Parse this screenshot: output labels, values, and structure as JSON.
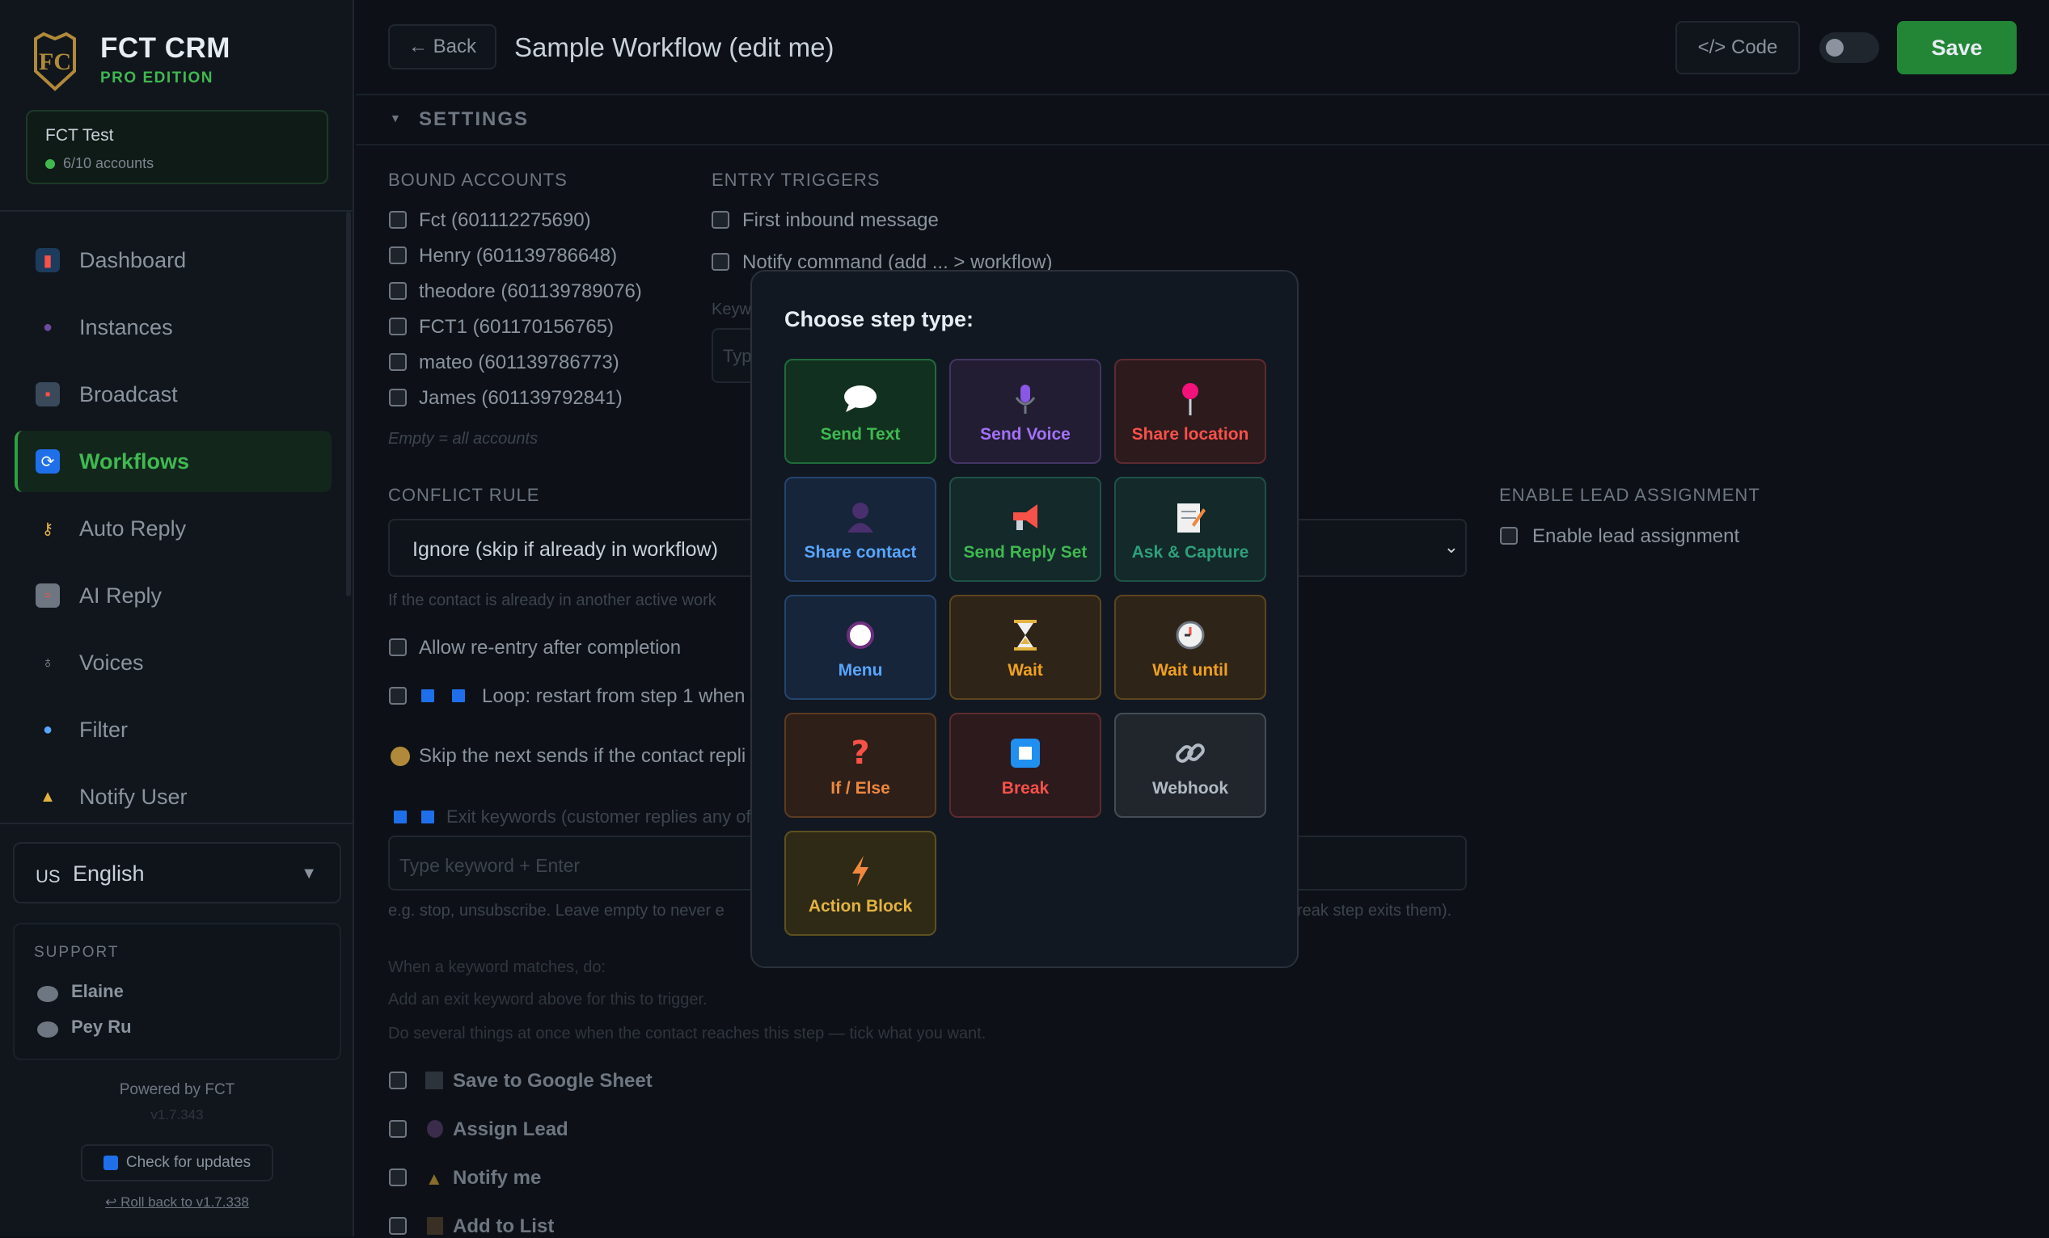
{
  "sidebar": {
    "brand": "FCT CRM",
    "edition": "PRO EDITION",
    "account": {
      "name": "FCT Test",
      "count": "6/10 accounts"
    },
    "nav": [
      {
        "label": "Dashboard",
        "icon": "chart-icon"
      },
      {
        "label": "Instances",
        "icon": "person-icon"
      },
      {
        "label": "Broadcast",
        "icon": "inbox-icon"
      },
      {
        "label": "Workflows",
        "icon": "refresh-icon",
        "active": true
      },
      {
        "label": "Auto Reply",
        "icon": "key-icon"
      },
      {
        "label": "AI Reply",
        "icon": "robot-icon"
      },
      {
        "label": "Voices",
        "icon": "microphone-icon"
      },
      {
        "label": "Filter",
        "icon": "magnifier-icon"
      },
      {
        "label": "Notify User",
        "icon": "bell-icon"
      }
    ],
    "language": {
      "flag": "US",
      "label": "English"
    },
    "support": {
      "heading": "SUPPORT",
      "people": [
        "Elaine",
        "Pey Ru"
      ]
    },
    "powered_by": "Powered by FCT",
    "version": "v1.7.343",
    "check_updates": "Check for updates",
    "rollback": "↩ Roll back to v1.7.338"
  },
  "header": {
    "back_label": "← Back",
    "title": "Sample Workflow (edit me)",
    "code_label": "</> Code",
    "save_label": "Save"
  },
  "settings": {
    "heading": "SETTINGS",
    "bound_accounts": {
      "heading": "BOUND ACCOUNTS",
      "items": [
        "Fct (601112275690)",
        "Henry (601139786648)",
        "theodore (601139789076)",
        "FCT1 (601170156765)",
        "mateo (601139786773)",
        "James (601139792841)"
      ],
      "hint": "Empty = all accounts"
    },
    "entry_triggers": {
      "heading": "ENTRY TRIGGERS",
      "items": [
        "First inbound message",
        "Notify command (add ... > workflow)"
      ],
      "keyword_label": "Keyw",
      "keyword_placeholder": "Typ"
    },
    "conflict_rule": {
      "heading": "CONFLICT RULE",
      "value": "Ignore (skip if already in workflow)",
      "hint": "If the contact is already in another active work"
    },
    "lead": {
      "heading": "ENABLE LEAD ASSIGNMENT",
      "label": "Enable lead assignment"
    },
    "allow_reentry": "Allow re-entry after completion",
    "loop_label": "Loop: restart from step 1 when",
    "skip_label": "Skip the next sends if the contact repli",
    "exit_keywords_label": "Exit keywords (customer replies any of",
    "keyword_input_placeholder": "Type keyword + Enter",
    "keyword_hint_left": "e.g. stop, unsubscribe. Leave empty to never e",
    "keyword_hint_right": "reak step exits them).",
    "when_match": "When a keyword matches, do:",
    "add_exit_hint": "Add an exit keyword above for this to trigger.",
    "several_hint": "Do several things at once when the contact reaches this step — tick what you want.",
    "actions": [
      "Save to Google Sheet",
      "Assign Lead",
      "Notify me",
      "Add to List"
    ]
  },
  "modal": {
    "title": "Choose step type:",
    "tiles": [
      {
        "label": "Send Text",
        "icon": "speech-bubble-icon",
        "color": "#3fb950",
        "bg": "#12301f",
        "border": "#1f6b3a"
      },
      {
        "label": "Send Voice",
        "icon": "microphone-icon",
        "color": "#a371f7",
        "bg": "#221d33",
        "border": "#433563"
      },
      {
        "label": "Share location",
        "icon": "pin-icon",
        "color": "#f85149",
        "bg": "#2d1a1d",
        "border": "#5c2b30"
      },
      {
        "label": "Share contact",
        "icon": "person-icon",
        "color": "#58a6ff",
        "bg": "#16253a",
        "border": "#24446c"
      },
      {
        "label": "Send Reply Set",
        "icon": "megaphone-icon",
        "color": "#3fb950",
        "bg": "#13292a",
        "border": "#1f5247"
      },
      {
        "label": "Ask & Capture",
        "icon": "memo-icon",
        "color": "#2ea07a",
        "bg": "#13292a",
        "border": "#1f5247"
      },
      {
        "label": "Menu",
        "icon": "circle-icon",
        "color": "#58a6ff",
        "bg": "#16253a",
        "border": "#24446c"
      },
      {
        "label": "Wait",
        "icon": "hourglass-icon",
        "color": "#f0a020",
        "bg": "#2e2417",
        "border": "#5c4520"
      },
      {
        "label": "Wait until",
        "icon": "clock-icon",
        "color": "#f0a020",
        "bg": "#2e2417",
        "border": "#5c4520"
      },
      {
        "label": "If / Else",
        "icon": "question-icon",
        "color": "#f0883e",
        "bg": "#2e2019",
        "border": "#5c3a22"
      },
      {
        "label": "Break",
        "icon": "stop-square-icon",
        "color": "#f85149",
        "bg": "#2d1a1d",
        "border": "#5c2b30"
      },
      {
        "label": "Webhook",
        "icon": "link-icon",
        "color": "#b1bac4",
        "bg": "#21262d",
        "border": "#444c56"
      },
      {
        "label": "Action Block",
        "icon": "lightning-icon",
        "color": "#e3b341",
        "bg": "#2e2a15",
        "border": "#5c5120"
      }
    ]
  }
}
